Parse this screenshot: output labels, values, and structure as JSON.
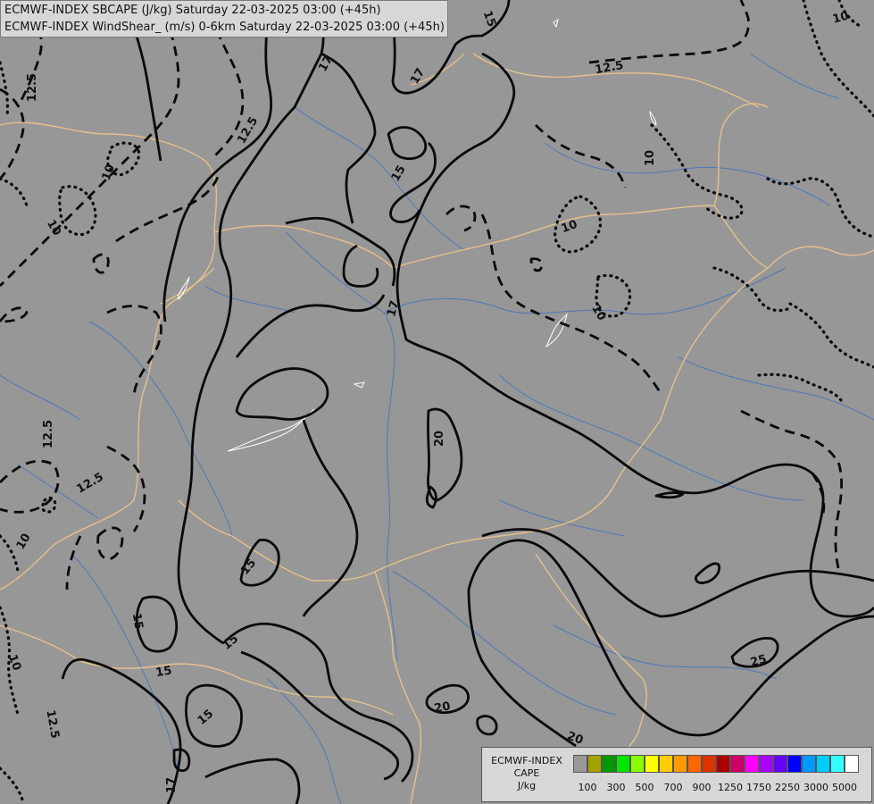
{
  "header": {
    "line1": "ECMWF-INDEX SBCAPE (J/kg) Saturday 22-03-2025 03:00 (+45h)",
    "line2": "ECMWF-INDEX WindShear_ (m/s) 0-6km Saturday 22-03-2025 03:00 (+45h)"
  },
  "legend": {
    "title": "ECMWF-INDEX",
    "variable": "CAPE",
    "unit": "J/kg",
    "colors": [
      "#999999",
      "#a3a300",
      "#009900",
      "#00e600",
      "#88ff00",
      "#ffff00",
      "#ffcc00",
      "#ff9900",
      "#ff6600",
      "#dd3300",
      "#aa0000",
      "#cc0066",
      "#ff00ff",
      "#aa00ff",
      "#6600ff",
      "#0000ff",
      "#0099ff",
      "#00ccff",
      "#33ffff",
      "#ffffff"
    ],
    "tick_labels": [
      "100",
      "300",
      "500",
      "700",
      "900",
      "1250",
      "1750",
      "2250",
      "3000",
      "5000"
    ]
  },
  "contour_labels": {
    "l1": "15",
    "l2": "17",
    "l3": "17",
    "l4": "12.5",
    "l5": "12.5",
    "l6": "10",
    "l7": "10",
    "l8": "15",
    "l9": "10",
    "l10": "10",
    "l11": "12.5",
    "l12": "10",
    "l13": "17",
    "l14": "20",
    "l15": "12.5",
    "l16": "12.5",
    "l17": "10",
    "l18": "15",
    "l19": "15",
    "l20": "15",
    "l21": "15",
    "l22": "15",
    "l23": "10",
    "l24": "12.5",
    "l25": "17",
    "l26": "20",
    "l27": "20",
    "l28": "25",
    "l29": "10"
  }
}
